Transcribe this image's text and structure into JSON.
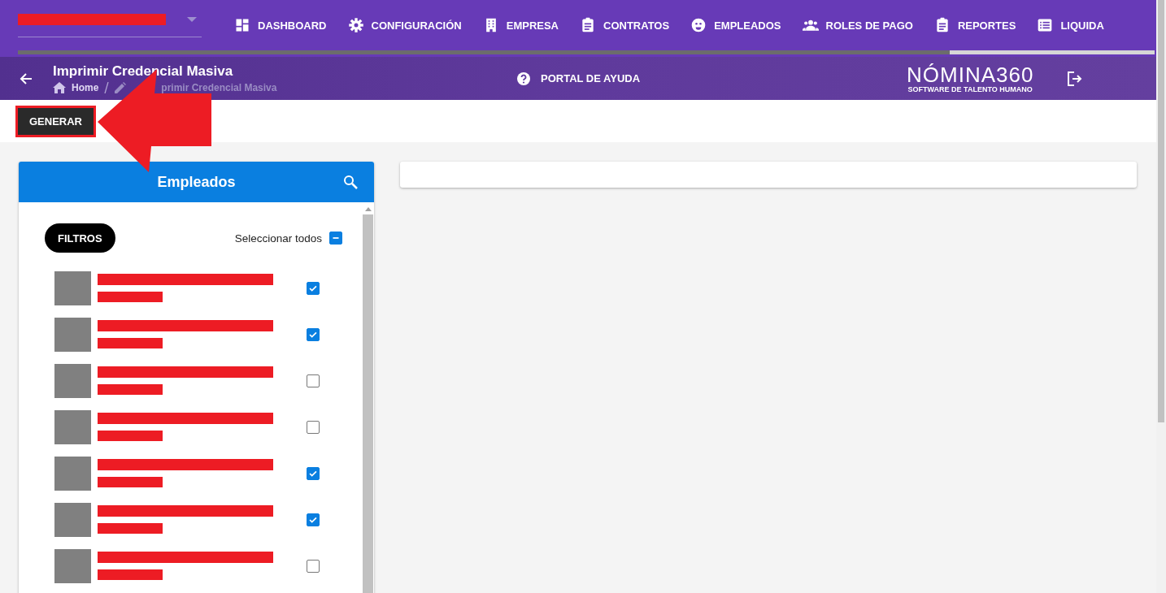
{
  "nav": {
    "items": [
      {
        "label": "DASHBOARD"
      },
      {
        "label": "CONFIGURACIÓN"
      },
      {
        "label": "EMPRESA"
      },
      {
        "label": "CONTRATOS"
      },
      {
        "label": "EMPLEADOS"
      },
      {
        "label": "ROLES DE PAGO"
      },
      {
        "label": "REPORTES"
      },
      {
        "label": "LIQUIDA"
      }
    ]
  },
  "header": {
    "title": "Imprimir Credencial Masiva",
    "breadcrumb": [
      "Home",
      "primir Credencial Masiva"
    ],
    "help": "PORTAL DE AYUDA",
    "logo": "NÓMINA360",
    "logo_tagline": "SOFTWARE DE TALENTO HUMANO"
  },
  "toolbar": {
    "button": "GENERAR"
  },
  "employees": {
    "title": "Empleados",
    "filters": "FILTROS",
    "select_all": "Seleccionar todos",
    "select_all_indeterminate": true,
    "rows": [
      {
        "checked": true
      },
      {
        "checked": true
      },
      {
        "checked": false
      },
      {
        "checked": false
      },
      {
        "checked": true
      },
      {
        "checked": true
      },
      {
        "checked": false
      }
    ]
  }
}
